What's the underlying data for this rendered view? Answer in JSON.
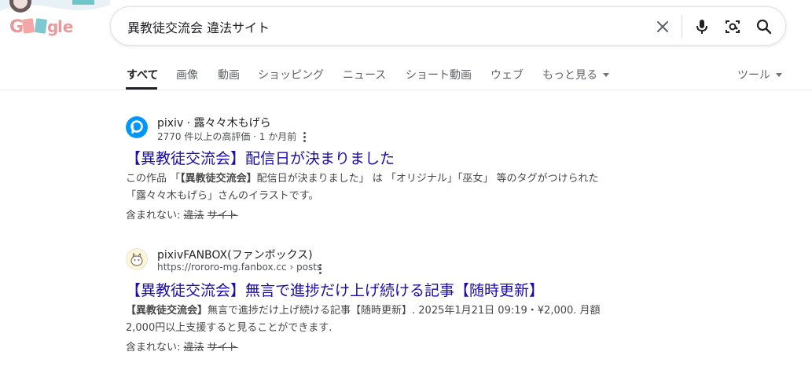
{
  "search": {
    "query": "異教徒交流会 違法サイト"
  },
  "tabs": [
    {
      "label": "すべて",
      "active": true
    },
    {
      "label": "画像"
    },
    {
      "label": "動画"
    },
    {
      "label": "ショッピング"
    },
    {
      "label": "ニュース"
    },
    {
      "label": "ショート動画"
    },
    {
      "label": "ウェブ"
    },
    {
      "label": "もっと見る"
    }
  ],
  "tools_label": "ツール",
  "results": [
    {
      "site": "pixiv · 露々々木もげら",
      "sub": "2770 件以上の高評価 · 1 か月前",
      "title": "【異教徒交流会】配信日が決まりました",
      "snippet_line1_pre": "この作品 「",
      "snippet_line1_bold": "【異教徒交流会】",
      "snippet_line1_post": "配信日が決まりました」 は 「オリジナル」「巫女」 等のタグがつけられた",
      "snippet_line2": "「露々々木もげら」さんのイラストです。",
      "missing_label": "含まれない:",
      "missing_word1": "違法",
      "missing_word2": "サイト"
    },
    {
      "site": "pixivFANBOX(ファンボックス)",
      "sub": "https://rororo-mg.fanbox.cc › posts",
      "title": "【異教徒交流会】無言で進捗だけ上げ続ける記事【随時更新】",
      "snippet_line1_bold": "【異教徒交流会】",
      "snippet_line1_post": "無言で進捗だけ上げ続ける記事【随時更新】. 2025年1月21日 09:19・¥2,000. 月額",
      "snippet_line2": "2,000円以上支援すると見ることができます.",
      "missing_label": "含まれない:",
      "missing_word1": "違法",
      "missing_word2": "サイト"
    }
  ],
  "colors": {
    "link": "#1a0dab",
    "pixiv_blue": "#0096fa"
  }
}
